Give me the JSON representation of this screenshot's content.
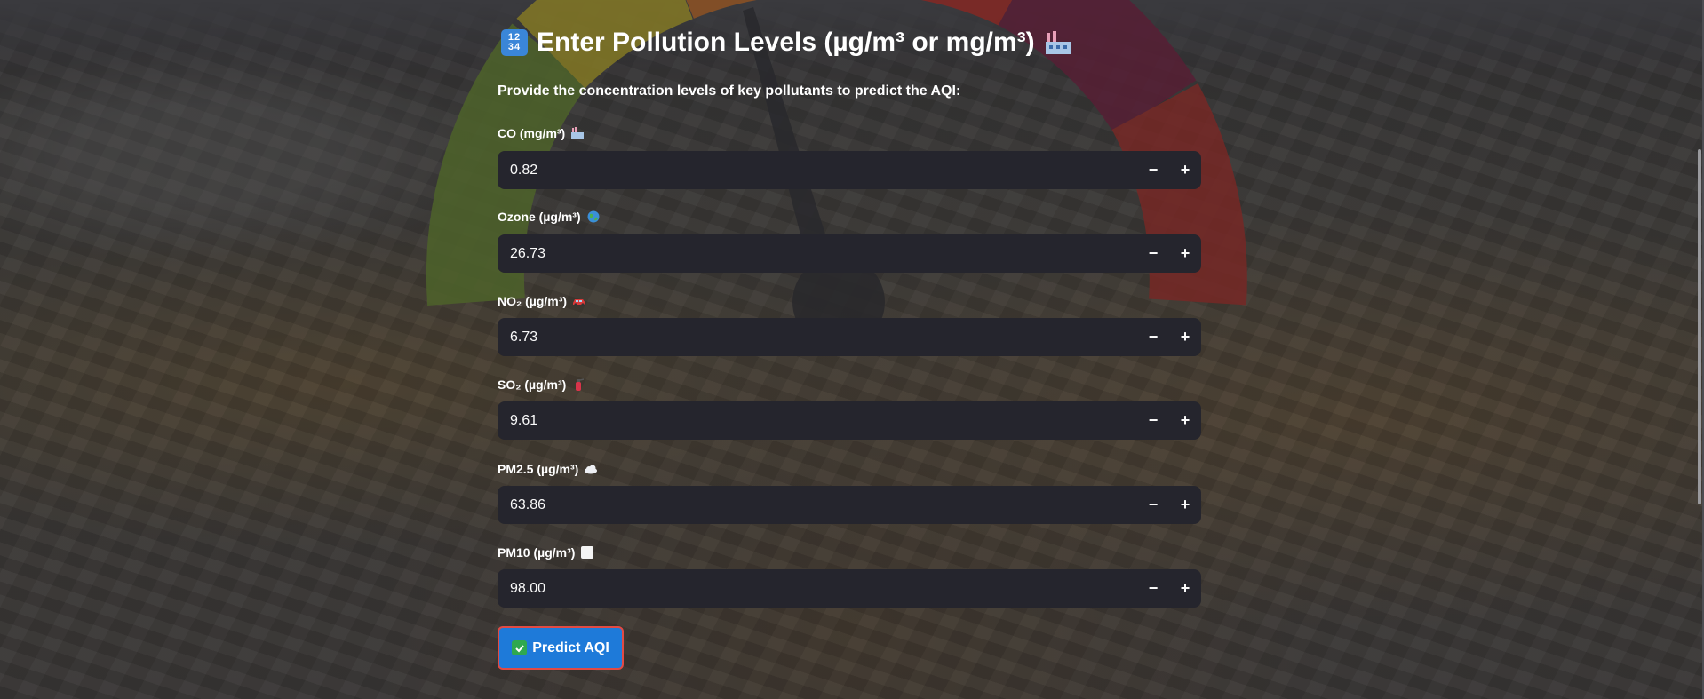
{
  "header": {
    "title": "Enter Pollution Levels (µg/m³ or mg/m³)",
    "title_icon": "input-numbers-icon",
    "title_trailing_icon": "factory-icon",
    "subtitle": "Provide the concentration levels of key pollutants to predict the AQI:"
  },
  "fields": [
    {
      "label": "CO (mg/m³)",
      "icon": "factory-icon",
      "value": "0.82"
    },
    {
      "label": "Ozone (µg/m³)",
      "icon": "globe-icon",
      "value": "26.73"
    },
    {
      "label": "NO₂ (µg/m³)",
      "icon": "car-icon",
      "value": "6.73"
    },
    {
      "label": "SO₂ (µg/m³)",
      "icon": "fire-extinguisher-icon",
      "value": "9.61"
    },
    {
      "label": "PM2.5 (µg/m³)",
      "icon": "cloud-icon",
      "value": "63.86"
    },
    {
      "label": "PM10 (µg/m³)",
      "icon": "white-square-icon",
      "value": "98.00"
    }
  ],
  "stepper": {
    "minus": "−",
    "plus": "+"
  },
  "predict_button": {
    "label": "Predict AQI",
    "icon": "check-mark-button-icon"
  },
  "colors": {
    "input_bg": "#25252d",
    "button_bg": "#1e7ad9",
    "button_border": "#e24a44",
    "gauge": [
      "#6b8f2a",
      "#c6b420",
      "#d9731f",
      "#c9291f",
      "#7a1a3c"
    ]
  }
}
